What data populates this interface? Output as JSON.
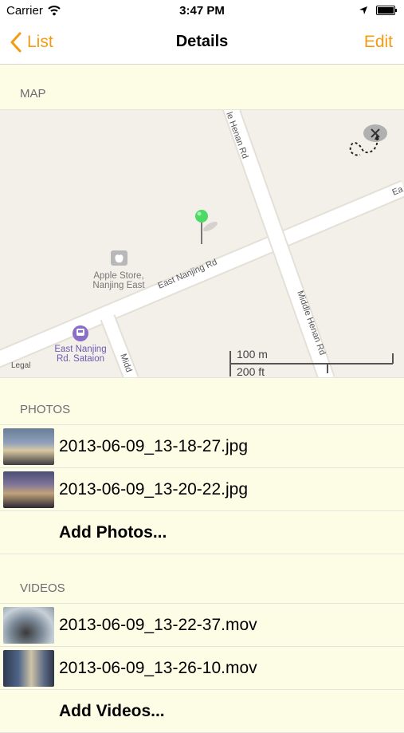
{
  "status_bar": {
    "carrier": "Carrier",
    "time": "3:47 PM",
    "battery_level": 1.0
  },
  "nav": {
    "back_label": "List",
    "title": "Details",
    "edit_label": "Edit"
  },
  "accent_color": "#f39c12",
  "sections": {
    "map_header": "MAP",
    "photos_header": "PHOTOS",
    "videos_header": "VIDEOS"
  },
  "map": {
    "streets": {
      "henan_top": "le Henan Rd",
      "east_nanjing": "East Nanjing Rd",
      "middle_henan": "Middle Henan Rd",
      "east_right": "Ea",
      "middle_bottom": "Midd"
    },
    "poi_apple": {
      "line1": "Apple Store,",
      "line2": "Nanjing East"
    },
    "poi_station": {
      "line1": "East Nanjing",
      "line2": "Rd. Sataion"
    },
    "scale": {
      "metric": "100 m",
      "imperial": "200 ft"
    },
    "legal": "Legal",
    "pin_color": "#4cd964",
    "icons": [
      "apple-store-icon",
      "metro-station-icon",
      "map-pin-icon",
      "route-badge-icon"
    ]
  },
  "photos": [
    {
      "name": "2013-06-09_13-18-27.jpg"
    },
    {
      "name": "2013-06-09_13-20-22.jpg"
    }
  ],
  "add_photos_label": "Add Photos...",
  "videos": [
    {
      "name": "2013-06-09_13-22-37.mov"
    },
    {
      "name": "2013-06-09_13-26-10.mov"
    }
  ],
  "add_videos_label": "Add Videos..."
}
